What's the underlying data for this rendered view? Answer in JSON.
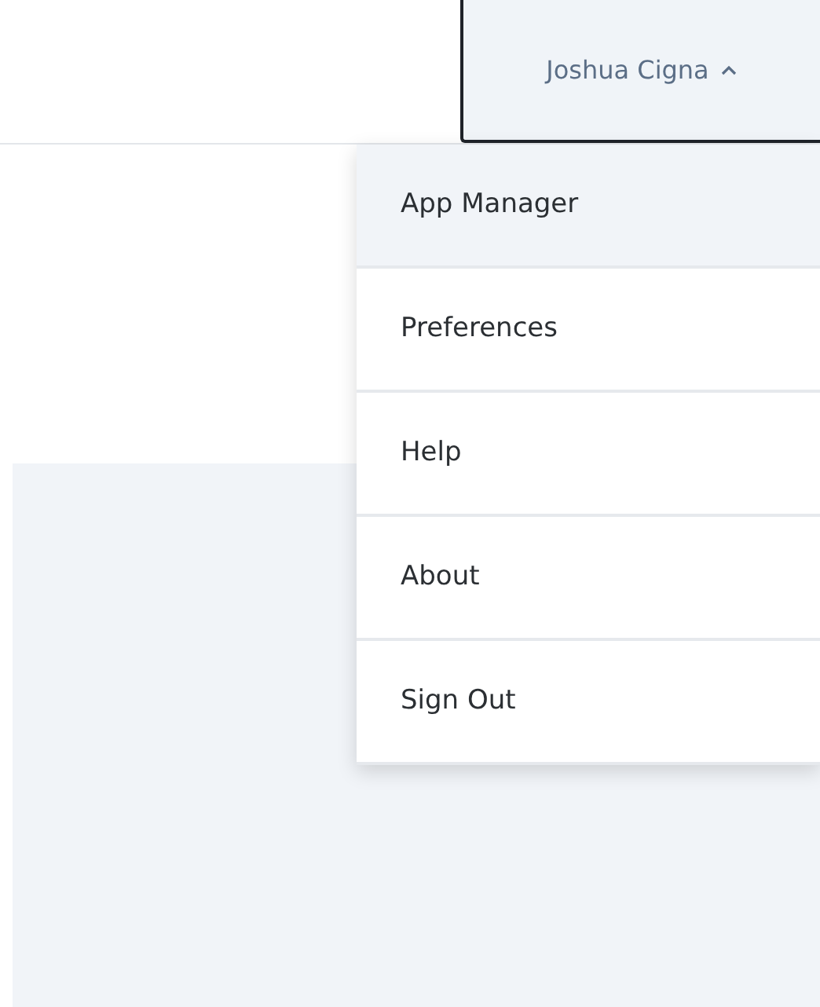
{
  "user_menu": {
    "name": "Joshua Cigna",
    "expanded": true,
    "items": [
      {
        "label": "App Manager",
        "selected": true
      },
      {
        "label": "Preferences",
        "selected": false
      },
      {
        "label": "Help",
        "selected": false
      },
      {
        "label": "About",
        "selected": false
      },
      {
        "label": "Sign Out",
        "selected": false
      }
    ]
  }
}
